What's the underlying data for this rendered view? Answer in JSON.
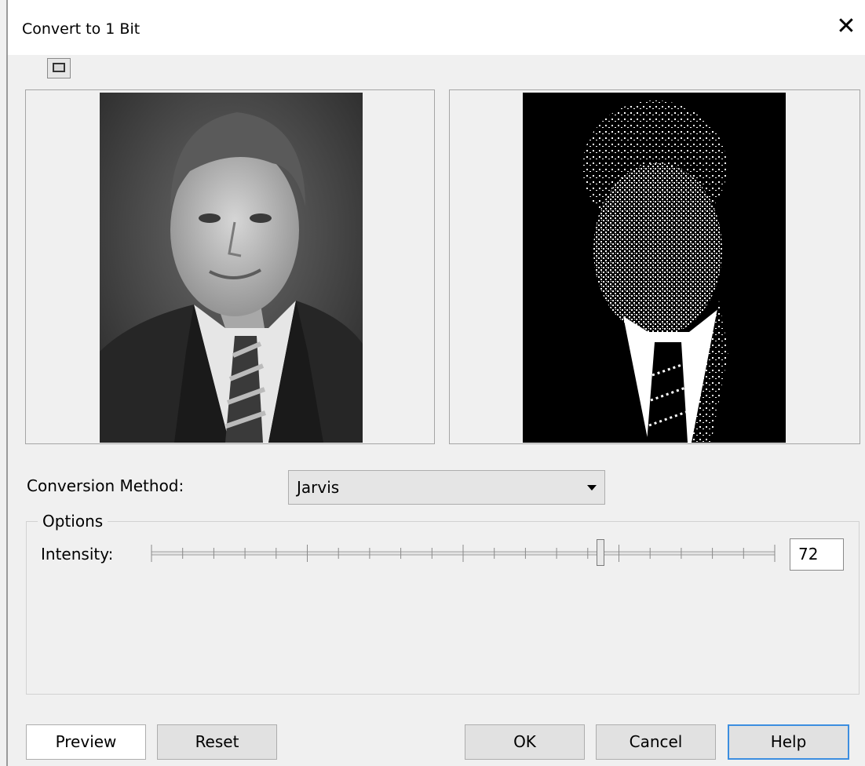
{
  "window": {
    "title": "Convert to 1 Bit",
    "close_icon": "close-icon",
    "view_toggle_icon": "single-preview-icon"
  },
  "conversion": {
    "method_label": "Conversion Method:",
    "method_value": "Jarvis"
  },
  "options": {
    "legend": "Options",
    "intensity_label": "Intensity:",
    "intensity_value": "72",
    "intensity_max": 100
  },
  "buttons": {
    "preview": "Preview",
    "reset": "Reset",
    "ok": "OK",
    "cancel": "Cancel",
    "help": "Help"
  },
  "colors": {
    "help_focus_border": "#3c8ee0",
    "dialog_background": "#f0f0f0"
  }
}
